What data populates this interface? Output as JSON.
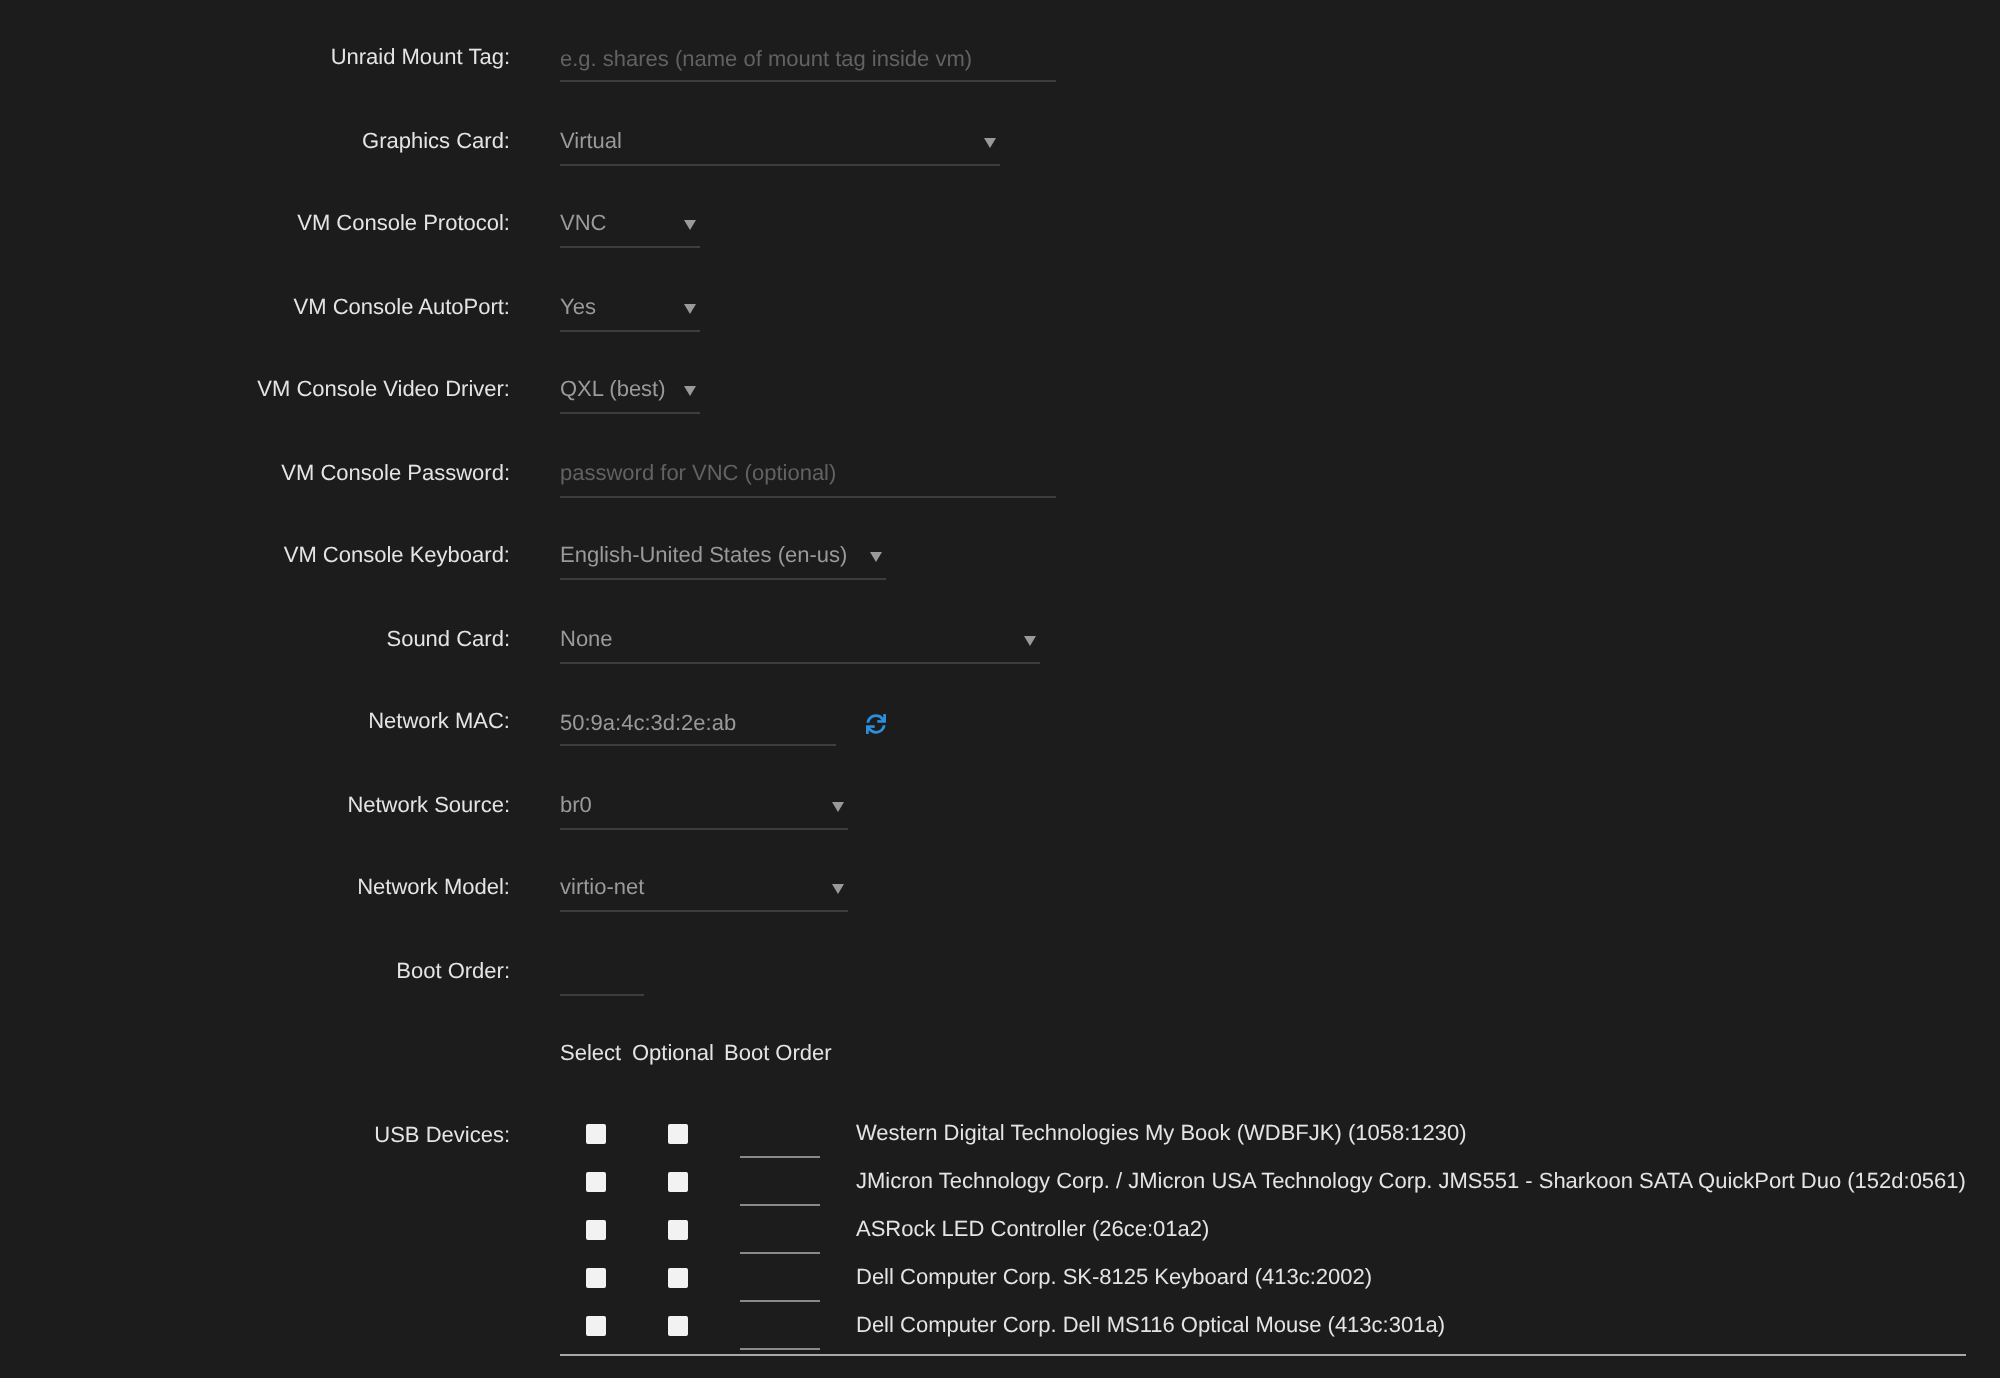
{
  "form": {
    "fields": [
      {
        "label": "Unraid Mount Tag:",
        "kind": "input",
        "placeholder": "e.g. shares (name of mount tag inside vm)"
      },
      {
        "label": "Graphics Card:",
        "kind": "select",
        "value": "Virtual"
      },
      {
        "label": "VM Console Protocol:",
        "kind": "select",
        "value": "VNC"
      },
      {
        "label": "VM Console AutoPort:",
        "kind": "select",
        "value": "Yes"
      },
      {
        "label": "VM Console Video Driver:",
        "kind": "select",
        "value": "QXL (best)"
      },
      {
        "label": "VM Console Password:",
        "kind": "input",
        "placeholder": "password for VNC (optional)"
      },
      {
        "label": "VM Console Keyboard:",
        "kind": "select",
        "value": "English-United States (en-us)"
      },
      {
        "label": "Sound Card:",
        "kind": "select",
        "value": "None"
      },
      {
        "label": "Network MAC:",
        "kind": "mac",
        "value": "50:9a:4c:3d:2e:ab"
      },
      {
        "label": "Network Source:",
        "kind": "select",
        "value": "br0"
      },
      {
        "label": "Network Model:",
        "kind": "select",
        "value": "virtio-net"
      },
      {
        "label": "Boot Order:",
        "kind": "input"
      }
    ]
  },
  "usb_devices": {
    "label": "USB Devices:",
    "columns": [
      "Select",
      "Optional",
      "Boot Order"
    ],
    "devices": [
      {
        "name": "Western Digital Technologies My Book (WDBFJK) (1058:1230)",
        "select": false,
        "optional": false
      },
      {
        "name": "JMicron Technology Corp. / JMicron USA Technology Corp. JMS551 - Sharkoon SATA QuickPort Duo (152d:0561)",
        "select": false,
        "optional": false
      },
      {
        "name": "ASRock LED Controller (26ce:01a2)",
        "select": false,
        "optional": false
      },
      {
        "name": "Dell Computer Corp. SK-8125 Keyboard (413c:2002)",
        "select": false,
        "optional": false
      },
      {
        "name": "Dell Computer Corp. Dell MS116 Optical Mouse (413c:301a)",
        "select": false,
        "optional": false
      }
    ]
  }
}
